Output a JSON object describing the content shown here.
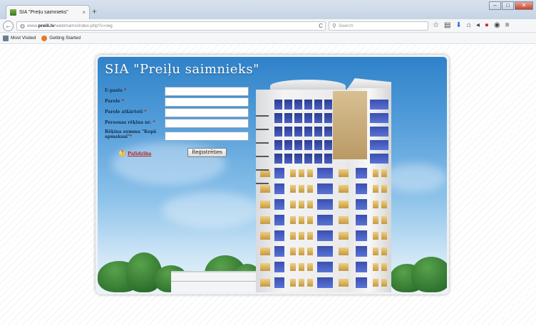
{
  "browser": {
    "tab_title": "SIA \"Preiļu saimnieks\"",
    "tab_close": "×",
    "new_tab": "+",
    "window_buttons": {
      "minimize": "–",
      "maximize": "□",
      "close": "✕"
    },
    "back_icon": "←",
    "url_prefix": "www.",
    "url_domain": "preili.lv",
    "url_path": "/webmams/index.php?c=reg",
    "reload_icon": "C",
    "search_placeholder": "Search",
    "toolbar_icons": [
      "star-icon",
      "reading-list-icon",
      "download-icon",
      "home-icon",
      "pocket-icon",
      "adblock-icon",
      "chat-icon",
      "menu-icon"
    ]
  },
  "bookmarks": [
    {
      "label": "Most Visited",
      "icon": "bookmark-folder-icon"
    },
    {
      "label": "Getting Started",
      "icon": "firefox-icon"
    }
  ],
  "page": {
    "title": "SIA \"Preiļu saimnieks\"",
    "form": {
      "fields": [
        {
          "label": "E-pasts",
          "required_mark": "*",
          "value": ""
        },
        {
          "label": "Parole",
          "required_mark": "*",
          "value": ""
        },
        {
          "label": "Parole atkārtoti",
          "required_mark": "*",
          "value": ""
        },
        {
          "label": "Personas rēķina nr.",
          "required_mark": "*",
          "value": ""
        },
        {
          "label": "Rēķina summa \"Kopā apmaksai\"",
          "required_mark": "*",
          "value": ""
        }
      ],
      "help_icon": "?",
      "help_label": "Palīdzība",
      "submit_label": "Reģistrēties"
    }
  },
  "colors": {
    "sky_top": "#2f82c9",
    "title_text": "#ffffff",
    "label_text": "#14304f",
    "required": "#cc0000",
    "help_link": "#b81f1f"
  }
}
